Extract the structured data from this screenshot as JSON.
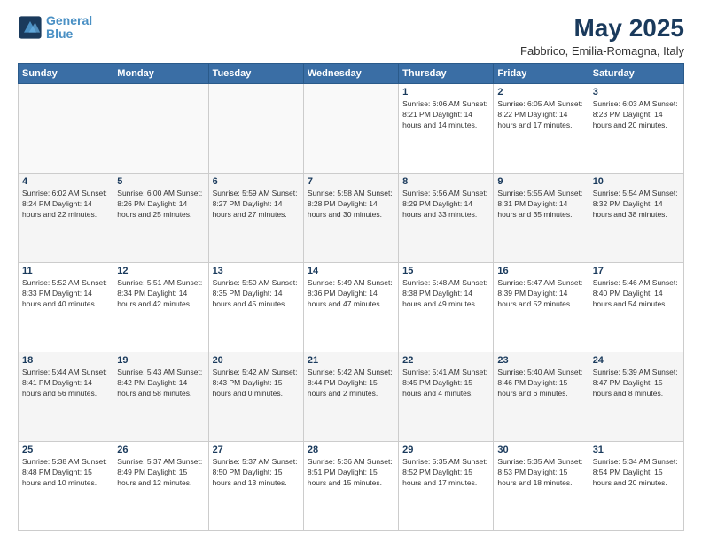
{
  "logo": {
    "line1": "General",
    "line2": "Blue"
  },
  "title": {
    "month_year": "May 2025",
    "location": "Fabbrico, Emilia-Romagna, Italy"
  },
  "days_of_week": [
    "Sunday",
    "Monday",
    "Tuesday",
    "Wednesday",
    "Thursday",
    "Friday",
    "Saturday"
  ],
  "weeks": [
    [
      {
        "day": "",
        "info": ""
      },
      {
        "day": "",
        "info": ""
      },
      {
        "day": "",
        "info": ""
      },
      {
        "day": "",
        "info": ""
      },
      {
        "day": "1",
        "info": "Sunrise: 6:06 AM\nSunset: 8:21 PM\nDaylight: 14 hours\nand 14 minutes."
      },
      {
        "day": "2",
        "info": "Sunrise: 6:05 AM\nSunset: 8:22 PM\nDaylight: 14 hours\nand 17 minutes."
      },
      {
        "day": "3",
        "info": "Sunrise: 6:03 AM\nSunset: 8:23 PM\nDaylight: 14 hours\nand 20 minutes."
      }
    ],
    [
      {
        "day": "4",
        "info": "Sunrise: 6:02 AM\nSunset: 8:24 PM\nDaylight: 14 hours\nand 22 minutes."
      },
      {
        "day": "5",
        "info": "Sunrise: 6:00 AM\nSunset: 8:26 PM\nDaylight: 14 hours\nand 25 minutes."
      },
      {
        "day": "6",
        "info": "Sunrise: 5:59 AM\nSunset: 8:27 PM\nDaylight: 14 hours\nand 27 minutes."
      },
      {
        "day": "7",
        "info": "Sunrise: 5:58 AM\nSunset: 8:28 PM\nDaylight: 14 hours\nand 30 minutes."
      },
      {
        "day": "8",
        "info": "Sunrise: 5:56 AM\nSunset: 8:29 PM\nDaylight: 14 hours\nand 33 minutes."
      },
      {
        "day": "9",
        "info": "Sunrise: 5:55 AM\nSunset: 8:31 PM\nDaylight: 14 hours\nand 35 minutes."
      },
      {
        "day": "10",
        "info": "Sunrise: 5:54 AM\nSunset: 8:32 PM\nDaylight: 14 hours\nand 38 minutes."
      }
    ],
    [
      {
        "day": "11",
        "info": "Sunrise: 5:52 AM\nSunset: 8:33 PM\nDaylight: 14 hours\nand 40 minutes."
      },
      {
        "day": "12",
        "info": "Sunrise: 5:51 AM\nSunset: 8:34 PM\nDaylight: 14 hours\nand 42 minutes."
      },
      {
        "day": "13",
        "info": "Sunrise: 5:50 AM\nSunset: 8:35 PM\nDaylight: 14 hours\nand 45 minutes."
      },
      {
        "day": "14",
        "info": "Sunrise: 5:49 AM\nSunset: 8:36 PM\nDaylight: 14 hours\nand 47 minutes."
      },
      {
        "day": "15",
        "info": "Sunrise: 5:48 AM\nSunset: 8:38 PM\nDaylight: 14 hours\nand 49 minutes."
      },
      {
        "day": "16",
        "info": "Sunrise: 5:47 AM\nSunset: 8:39 PM\nDaylight: 14 hours\nand 52 minutes."
      },
      {
        "day": "17",
        "info": "Sunrise: 5:46 AM\nSunset: 8:40 PM\nDaylight: 14 hours\nand 54 minutes."
      }
    ],
    [
      {
        "day": "18",
        "info": "Sunrise: 5:44 AM\nSunset: 8:41 PM\nDaylight: 14 hours\nand 56 minutes."
      },
      {
        "day": "19",
        "info": "Sunrise: 5:43 AM\nSunset: 8:42 PM\nDaylight: 14 hours\nand 58 minutes."
      },
      {
        "day": "20",
        "info": "Sunrise: 5:42 AM\nSunset: 8:43 PM\nDaylight: 15 hours\nand 0 minutes."
      },
      {
        "day": "21",
        "info": "Sunrise: 5:42 AM\nSunset: 8:44 PM\nDaylight: 15 hours\nand 2 minutes."
      },
      {
        "day": "22",
        "info": "Sunrise: 5:41 AM\nSunset: 8:45 PM\nDaylight: 15 hours\nand 4 minutes."
      },
      {
        "day": "23",
        "info": "Sunrise: 5:40 AM\nSunset: 8:46 PM\nDaylight: 15 hours\nand 6 minutes."
      },
      {
        "day": "24",
        "info": "Sunrise: 5:39 AM\nSunset: 8:47 PM\nDaylight: 15 hours\nand 8 minutes."
      }
    ],
    [
      {
        "day": "25",
        "info": "Sunrise: 5:38 AM\nSunset: 8:48 PM\nDaylight: 15 hours\nand 10 minutes."
      },
      {
        "day": "26",
        "info": "Sunrise: 5:37 AM\nSunset: 8:49 PM\nDaylight: 15 hours\nand 12 minutes."
      },
      {
        "day": "27",
        "info": "Sunrise: 5:37 AM\nSunset: 8:50 PM\nDaylight: 15 hours\nand 13 minutes."
      },
      {
        "day": "28",
        "info": "Sunrise: 5:36 AM\nSunset: 8:51 PM\nDaylight: 15 hours\nand 15 minutes."
      },
      {
        "day": "29",
        "info": "Sunrise: 5:35 AM\nSunset: 8:52 PM\nDaylight: 15 hours\nand 17 minutes."
      },
      {
        "day": "30",
        "info": "Sunrise: 5:35 AM\nSunset: 8:53 PM\nDaylight: 15 hours\nand 18 minutes."
      },
      {
        "day": "31",
        "info": "Sunrise: 5:34 AM\nSunset: 8:54 PM\nDaylight: 15 hours\nand 20 minutes."
      }
    ]
  ]
}
